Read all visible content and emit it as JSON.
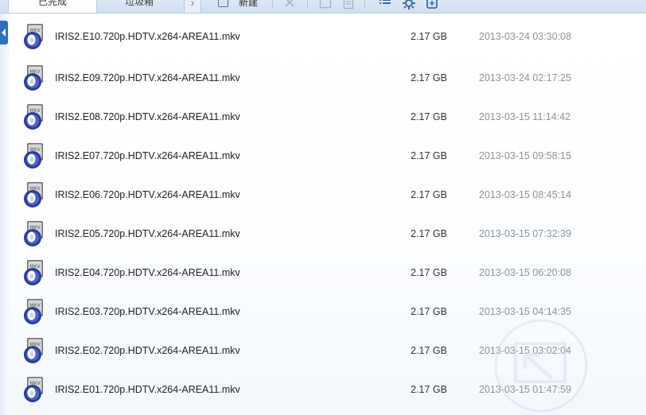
{
  "toolbar": {
    "tabs": [
      {
        "label": "已完成",
        "active": true
      },
      {
        "label": "垃圾箱",
        "active": false
      }
    ],
    "new_label": "新建",
    "icons": [
      "expand-arrow-icon",
      "new-file-icon",
      "close-icon",
      "window-icon",
      "document-icon",
      "list-view-icon",
      "gear-icon",
      "export-icon"
    ]
  },
  "files": [
    {
      "name": "IRIS2.E10.720p.HDTV.x264-AREA11.mkv",
      "size": "2.17 GB",
      "date": "2013-03-24 03:30:08"
    },
    {
      "name": "IRIS2.E09.720p.HDTV.x264-AREA11.mkv",
      "size": "2.17 GB",
      "date": "2013-03-24 02:17:25"
    },
    {
      "name": "IRIS2.E08.720p.HDTV.x264-AREA11.mkv",
      "size": "2.17 GB",
      "date": "2013-03-15 11:14:42"
    },
    {
      "name": "IRIS2.E07.720p.HDTV.x264-AREA11.mkv",
      "size": "2.17 GB",
      "date": "2013-03-15 09:58:15"
    },
    {
      "name": "IRIS2.E06.720p.HDTV.x264-AREA11.mkv",
      "size": "2.17 GB",
      "date": "2013-03-15 08:45:14"
    },
    {
      "name": "IRIS2.E05.720p.HDTV.x264-AREA11.mkv",
      "size": "2.17 GB",
      "date": "2013-03-15 07:32:39"
    },
    {
      "name": "IRIS2.E04.720p.HDTV.x264-AREA11.mkv",
      "size": "2.17 GB",
      "date": "2013-03-15 06:20:08"
    },
    {
      "name": "IRIS2.E03.720p.HDTV.x264-AREA11.mkv",
      "size": "2.17 GB",
      "date": "2013-03-15 04:14:35"
    },
    {
      "name": "IRIS2.E02.720p.HDTV.x264-AREA11.mkv",
      "size": "2.17 GB",
      "date": "2013-03-15 03:02:04"
    },
    {
      "name": "IRIS2.E01.720p.HDTV.x264-AREA11.mkv",
      "size": "2.17 GB",
      "date": "2013-03-15 01:47:59"
    }
  ],
  "file_icon": {
    "name": "mkv-file-icon",
    "badge": "MKV"
  },
  "colors": {
    "accent": "#2c6fbf",
    "date_text": "#8d9399",
    "background": "#f3f8fd"
  }
}
